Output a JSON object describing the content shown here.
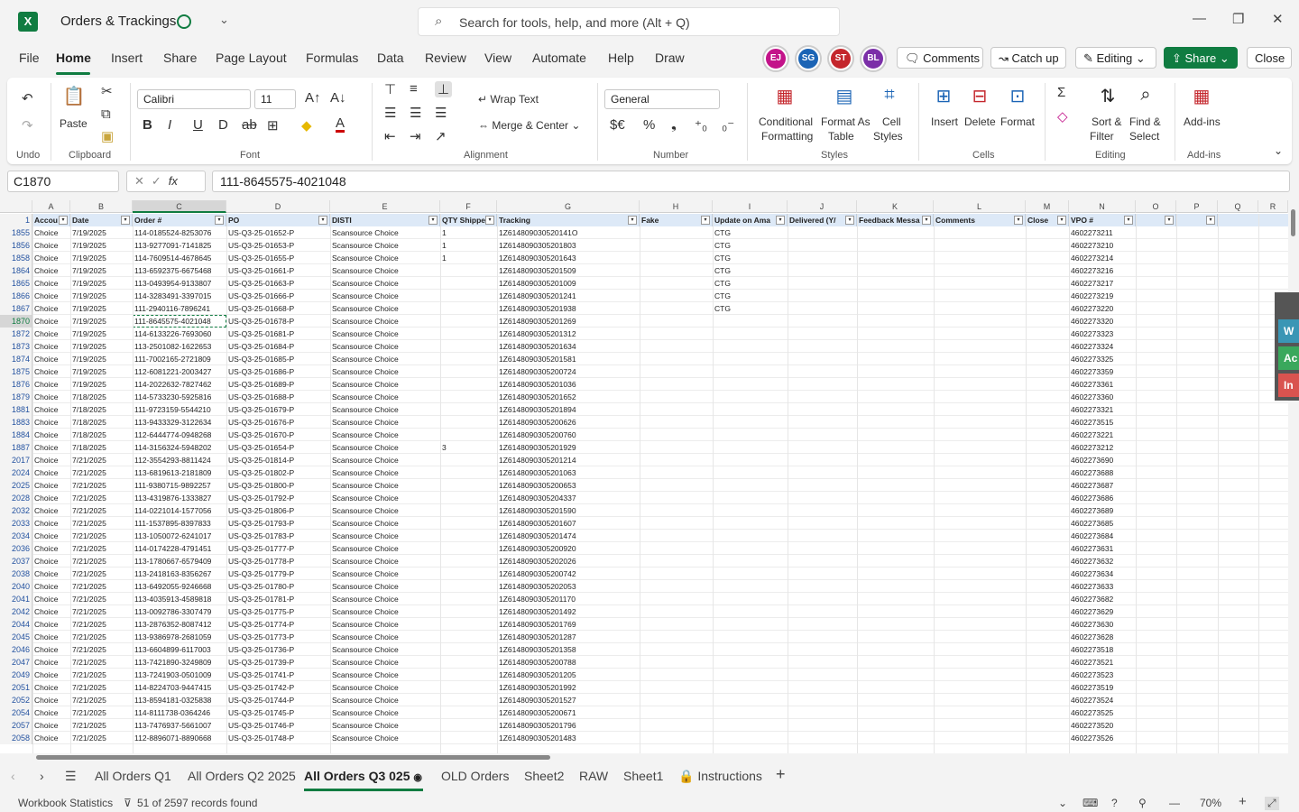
{
  "app": {
    "title": "Orders & Trackings",
    "logo": "X"
  },
  "search": {
    "placeholder": "Search for tools, help, and more (Alt + Q)"
  },
  "window_controls": {
    "minimize": "—",
    "maximize": "❐",
    "close": "✕"
  },
  "menu": [
    "File",
    "Home",
    "Insert",
    "Share",
    "Page Layout",
    "Formulas",
    "Data",
    "Review",
    "View",
    "Automate",
    "Help",
    "Draw"
  ],
  "active_menu": "Home",
  "collaborators": [
    {
      "initials": "EJ",
      "color": "#c3138a"
    },
    {
      "initials": "SG",
      "color": "#1b64b5"
    },
    {
      "initials": "ST",
      "color": "#c4262c"
    },
    {
      "initials": "BL",
      "color": "#7b2fa8"
    }
  ],
  "top_buttons": {
    "comments": "Comments",
    "catchup": "Catch up",
    "editing": "Editing",
    "share": "Share",
    "close": "Close"
  },
  "ribbon": {
    "undo_label": "Undo",
    "clipboard": {
      "label": "Clipboard",
      "paste": "Paste"
    },
    "font": {
      "label": "Font",
      "family": "Calibri",
      "size": "11"
    },
    "alignment": {
      "label": "Alignment",
      "wrap": "Wrap Text",
      "merge": "Merge & Center"
    },
    "number": {
      "label": "Number",
      "format": "General",
      "currency": "$€",
      "percent": "%",
      "comma": "❟"
    },
    "styles": {
      "label": "Styles",
      "conditional": "Conditional",
      "conditional2": "Formatting",
      "format_table": "Format As",
      "format_table2": "Table",
      "cell_styles": "Cell",
      "cell_styles2": "Styles"
    },
    "cells": {
      "label": "Cells",
      "insert": "Insert",
      "delete": "Delete",
      "format": "Format"
    },
    "editing": {
      "label": "Editing",
      "sort": "Sort &",
      "sort2": "Filter",
      "find": "Find &",
      "find2": "Select"
    },
    "addins": {
      "label": "Add-ins",
      "addins": "Add-ins"
    }
  },
  "formula_bar": {
    "namebox": "C1870",
    "fx": "fx",
    "formula": "111-8645575-4021048"
  },
  "columns": [
    "A",
    "B",
    "C",
    "D",
    "E",
    "F",
    "G",
    "H",
    "I",
    "J",
    "K",
    "L",
    "M",
    "N",
    "O",
    "P",
    "Q",
    "R"
  ],
  "header_row": {
    "num": "1",
    "cells": [
      "Accou",
      "Date",
      "Order #",
      "PO",
      "DISTI",
      "QTY Shippe",
      "Tracking",
      "Fake",
      "Update on Ama",
      "Delivered (Y/",
      "Feedback Messa",
      "Comments",
      "Close",
      "VPO #",
      "",
      ""
    ]
  },
  "rows": [
    [
      "1855",
      "Choice",
      "7/19/2025",
      "114-0185524-8253076",
      "US-Q3-25-01652-P",
      "Scansource Choice",
      "1",
      "1Z614809030520141O",
      "",
      "CTG",
      "",
      "",
      "",
      "",
      "4602273211"
    ],
    [
      "1856",
      "Choice",
      "7/19/2025",
      "113-9277091-7141825",
      "US-Q3-25-01653-P",
      "Scansource Choice",
      "1",
      "1Z6148090305201803",
      "",
      "CTG",
      "",
      "",
      "",
      "",
      "4602273210"
    ],
    [
      "1858",
      "Choice",
      "7/19/2025",
      "114-7609514-4678645",
      "US-Q3-25-01655-P",
      "Scansource Choice",
      "1",
      "1Z6148090305201643",
      "",
      "CTG",
      "",
      "",
      "",
      "",
      "4602273214"
    ],
    [
      "1864",
      "Choice",
      "7/19/2025",
      "113-6592375-6675468",
      "US-Q3-25-01661-P",
      "Scansource Choice",
      "",
      "1Z6148090305201509",
      "",
      "CTG",
      "",
      "",
      "",
      "",
      "4602273216"
    ],
    [
      "1865",
      "Choice",
      "7/19/2025",
      "113-0493954-9133807",
      "US-Q3-25-01663-P",
      "Scansource Choice",
      "",
      "1Z6148090305201009",
      "",
      "CTG",
      "",
      "",
      "",
      "",
      "4602273217"
    ],
    [
      "1866",
      "Choice",
      "7/19/2025",
      "114-3283491-3397015",
      "US-Q3-25-01666-P",
      "Scansource Choice",
      "",
      "1Z6148090305201241",
      "",
      "CTG",
      "",
      "",
      "",
      "",
      "4602273219"
    ],
    [
      "1867",
      "Choice",
      "7/19/2025",
      "111-2940116-7896241",
      "US-Q3-25-01668-P",
      "Scansource Choice",
      "",
      "1Z6148090305201938",
      "",
      "CTG",
      "",
      "",
      "",
      "",
      "4602273220"
    ],
    [
      "1870",
      "Choice",
      "7/19/2025",
      "111-8645575-4021048",
      "US-Q3-25-01678-P",
      "Scansource Choice",
      "",
      "1Z6148090305201269",
      "",
      "",
      "",
      "",
      "",
      "",
      "4602273320"
    ],
    [
      "1872",
      "Choice",
      "7/19/2025",
      "114-6133226-7693060",
      "US-Q3-25-01681-P",
      "Scansource Choice",
      "",
      "1Z6148090305201312",
      "",
      "",
      "",
      "",
      "",
      "",
      "4602273323"
    ],
    [
      "1873",
      "Choice",
      "7/19/2025",
      "113-2501082-1622653",
      "US-Q3-25-01684-P",
      "Scansource Choice",
      "",
      "1Z6148090305201634",
      "",
      "",
      "",
      "",
      "",
      "",
      "4602273324"
    ],
    [
      "1874",
      "Choice",
      "7/19/2025",
      "111-7002165-2721809",
      "US-Q3-25-01685-P",
      "Scansource Choice",
      "",
      "1Z6148090305201581",
      "",
      "",
      "",
      "",
      "",
      "",
      "4602273325"
    ],
    [
      "1875",
      "Choice",
      "7/19/2025",
      "112-6081221-2003427",
      "US-Q3-25-01686-P",
      "Scansource Choice",
      "",
      "1Z6148090305200724",
      "",
      "",
      "",
      "",
      "",
      "",
      "4602273359"
    ],
    [
      "1876",
      "Choice",
      "7/19/2025",
      "114-2022632-7827462",
      "US-Q3-25-01689-P",
      "Scansource Choice",
      "",
      "1Z6148090305201036",
      "",
      "",
      "",
      "",
      "",
      "",
      "4602273361"
    ],
    [
      "1879",
      "Choice",
      "7/18/2025",
      "114-5733230-5925816",
      "US-Q3-25-01688-P",
      "Scansource Choice",
      "",
      "1Z6148090305201652",
      "",
      "",
      "",
      "",
      "",
      "",
      "4602273360"
    ],
    [
      "1881",
      "Choice",
      "7/18/2025",
      "111-9723159-5544210",
      "US-Q3-25-01679-P",
      "Scansource Choice",
      "",
      "1Z6148090305201894",
      "",
      "",
      "",
      "",
      "",
      "",
      "4602273321"
    ],
    [
      "1883",
      "Choice",
      "7/18/2025",
      "113-9433329-3122634",
      "US-Q3-25-01676-P",
      "Scansource Choice",
      "",
      "1Z6148090305200626",
      "",
      "",
      "",
      "",
      "",
      "",
      "4602273515"
    ],
    [
      "1884",
      "Choice",
      "7/18/2025",
      "112-6444774-0948268",
      "US-Q3-25-01670-P",
      "Scansource Choice",
      "",
      "1Z6148090305200760",
      "",
      "",
      "",
      "",
      "",
      "",
      "4602273221"
    ],
    [
      "1887",
      "Choice",
      "7/18/2025",
      "114-3156324-5948202",
      "US-Q3-25-01654-P",
      "Scansource Choice",
      "3",
      "1Z6148090305201929",
      "",
      "",
      "",
      "",
      "",
      "",
      "4602273212"
    ],
    [
      "2017",
      "Choice",
      "7/21/2025",
      "112-3554293-8811424",
      "US-Q3-25-01814-P",
      "Scansource Choice",
      "",
      "1Z6148090305201214",
      "",
      "",
      "",
      "",
      "",
      "",
      "4602273690"
    ],
    [
      "2024",
      "Choice",
      "7/21/2025",
      "113-6819613-2181809",
      "US-Q3-25-01802-P",
      "Scansource Choice",
      "",
      "1Z6148090305201063",
      "",
      "",
      "",
      "",
      "",
      "",
      "4602273688"
    ],
    [
      "2025",
      "Choice",
      "7/21/2025",
      "111-9380715-9892257",
      "US-Q3-25-01800-P",
      "Scansource Choice",
      "",
      "1Z6148090305200653",
      "",
      "",
      "",
      "",
      "",
      "",
      "4602273687"
    ],
    [
      "2028",
      "Choice",
      "7/21/2025",
      "113-4319876-1333827",
      "US-Q3-25-01792-P",
      "Scansource Choice",
      "",
      "1Z6148090305204337",
      "",
      "",
      "",
      "",
      "",
      "",
      "4602273686"
    ],
    [
      "2032",
      "Choice",
      "7/21/2025",
      "114-0221014-1577056",
      "US-Q3-25-01806-P",
      "Scansource Choice",
      "",
      "1Z6148090305201590",
      "",
      "",
      "",
      "",
      "",
      "",
      "4602273689"
    ],
    [
      "2033",
      "Choice",
      "7/21/2025",
      "111-1537895-8397833",
      "US-Q3-25-01793-P",
      "Scansource Choice",
      "",
      "1Z6148090305201607",
      "",
      "",
      "",
      "",
      "",
      "",
      "4602273685"
    ],
    [
      "2034",
      "Choice",
      "7/21/2025",
      "113-1050072-6241017",
      "US-Q3-25-01783-P",
      "Scansource Choice",
      "",
      "1Z6148090305201474",
      "",
      "",
      "",
      "",
      "",
      "",
      "4602273684"
    ],
    [
      "2036",
      "Choice",
      "7/21/2025",
      "114-0174228-4791451",
      "US-Q3-25-01777-P",
      "Scansource Choice",
      "",
      "1Z6148090305200920",
      "",
      "",
      "",
      "",
      "",
      "",
      "4602273631"
    ],
    [
      "2037",
      "Choice",
      "7/21/2025",
      "113-1780667-6579409",
      "US-Q3-25-01778-P",
      "Scansource Choice",
      "",
      "1Z6148090305202026",
      "",
      "",
      "",
      "",
      "",
      "",
      "4602273632"
    ],
    [
      "2038",
      "Choice",
      "7/21/2025",
      "113-2418163-8356267",
      "US-Q3-25-01779-P",
      "Scansource Choice",
      "",
      "1Z6148090305200742",
      "",
      "",
      "",
      "",
      "",
      "",
      "4602273634"
    ],
    [
      "2040",
      "Choice",
      "7/21/2025",
      "113-6492055-9246668",
      "US-Q3-25-01780-P",
      "Scansource Choice",
      "",
      "1Z6148090305202053",
      "",
      "",
      "",
      "",
      "",
      "",
      "4602273633"
    ],
    [
      "2041",
      "Choice",
      "7/21/2025",
      "113-4035913-4589818",
      "US-Q3-25-01781-P",
      "Scansource Choice",
      "",
      "1Z6148090305201170",
      "",
      "",
      "",
      "",
      "",
      "",
      "4602273682"
    ],
    [
      "2042",
      "Choice",
      "7/21/2025",
      "113-0092786-3307479",
      "US-Q3-25-01775-P",
      "Scansource Choice",
      "",
      "1Z6148090305201492",
      "",
      "",
      "",
      "",
      "",
      "",
      "4602273629"
    ],
    [
      "2044",
      "Choice",
      "7/21/2025",
      "113-2876352-8087412",
      "US-Q3-25-01774-P",
      "Scansource Choice",
      "",
      "1Z6148090305201769",
      "",
      "",
      "",
      "",
      "",
      "",
      "4602273630"
    ],
    [
      "2045",
      "Choice",
      "7/21/2025",
      "113-9386978-2681059",
      "US-Q3-25-01773-P",
      "Scansource Choice",
      "",
      "1Z6148090305201287",
      "",
      "",
      "",
      "",
      "",
      "",
      "4602273628"
    ],
    [
      "2046",
      "Choice",
      "7/21/2025",
      "113-6604899-6117003",
      "US-Q3-25-01736-P",
      "Scansource Choice",
      "",
      "1Z6148090305201358",
      "",
      "",
      "",
      "",
      "",
      "",
      "4602273518"
    ],
    [
      "2047",
      "Choice",
      "7/21/2025",
      "113-7421890-3249809",
      "US-Q3-25-01739-P",
      "Scansource Choice",
      "",
      "1Z6148090305200788",
      "",
      "",
      "",
      "",
      "",
      "",
      "4602273521"
    ],
    [
      "2049",
      "Choice",
      "7/21/2025",
      "113-7241903-0501009",
      "US-Q3-25-01741-P",
      "Scansource Choice",
      "",
      "1Z6148090305201205",
      "",
      "",
      "",
      "",
      "",
      "",
      "4602273523"
    ],
    [
      "2051",
      "Choice",
      "7/21/2025",
      "114-8224703-9447415",
      "US-Q3-25-01742-P",
      "Scansource Choice",
      "",
      "1Z6148090305201992",
      "",
      "",
      "",
      "",
      "",
      "",
      "4602273519"
    ],
    [
      "2052",
      "Choice",
      "7/21/2025",
      "113-8594181-0325838",
      "US-Q3-25-01744-P",
      "Scansource Choice",
      "",
      "1Z6148090305201527",
      "",
      "",
      "",
      "",
      "",
      "",
      "4602273524"
    ],
    [
      "2054",
      "Choice",
      "7/21/2025",
      "114-8111738-0364246",
      "US-Q3-25-01745-P",
      "Scansource Choice",
      "",
      "1Z6148090305200671",
      "",
      "",
      "",
      "",
      "",
      "",
      "4602273525"
    ],
    [
      "2057",
      "Choice",
      "7/21/2025",
      "113-7476937-5661007",
      "US-Q3-25-01746-P",
      "Scansource Choice",
      "",
      "1Z6148090305201796",
      "",
      "",
      "",
      "",
      "",
      "",
      "4602273520"
    ],
    [
      "2058",
      "Choice",
      "7/21/2025",
      "112-8896071-8890668",
      "US-Q3-25-01748-P",
      "Scansource Choice",
      "",
      "1Z6148090305201483",
      "",
      "",
      "",
      "",
      "",
      "",
      "4602273526"
    ]
  ],
  "side_panel": [
    "W",
    "Ac",
    "In"
  ],
  "tabs": [
    "All Orders Q1",
    "All Orders Q2 2025",
    "All Orders Q3 025",
    "OLD Orders",
    "Sheet2",
    "RAW",
    "Sheet1",
    "Instructions"
  ],
  "active_tab": "All Orders Q3 025",
  "status": {
    "workbook_stats": "Workbook Statistics",
    "records": "51 of 2597 records found",
    "zoom": "70%"
  }
}
